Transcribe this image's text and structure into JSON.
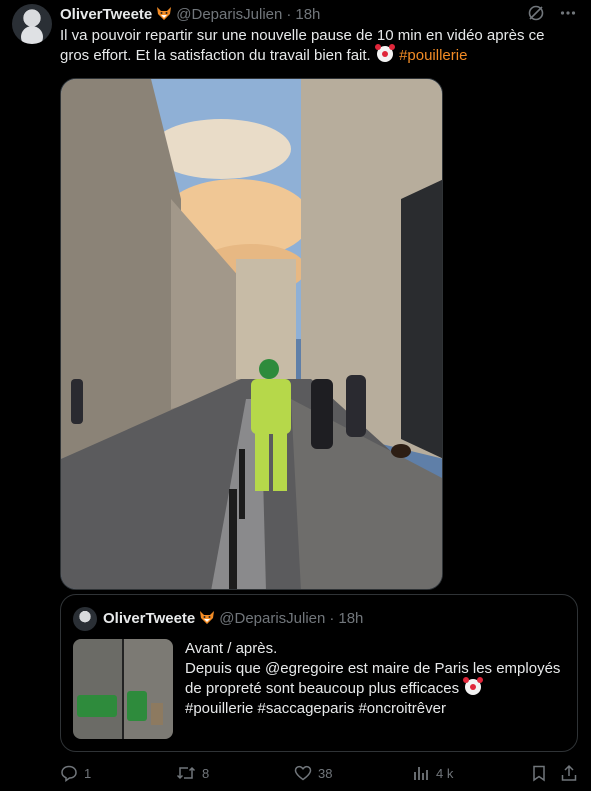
{
  "post": {
    "author_name": "OliverTweete",
    "author_handle": "@DeparisJulien",
    "separator": "·",
    "time": "18h",
    "text_line1": "Il va pouvoir repartir sur une nouvelle pause de 10 min en vidéo après ce",
    "text_line2": "gros effort. Et la satisfaction du travail bien fait.",
    "hashtag": "#pouillerie"
  },
  "quote": {
    "author_name": "OliverTweete",
    "author_handle": "@DeparisJulien",
    "separator": "·",
    "time": "18h",
    "line1": "Avant / après.",
    "line2": "Depuis que @egregoire est maire de Paris les employés",
    "line3": "de propreté sont beaucoup plus efficaces",
    "line4": "#pouillerie #saccageparis #oncroitrêver"
  },
  "actions": {
    "replies": "1",
    "reposts": "8",
    "likes": "38",
    "views": "4 k"
  },
  "icons": {
    "fox": "fox-emoji-icon",
    "clown": "clown-emoji-icon",
    "grok": "grok-icon",
    "more": "more-icon",
    "reply": "reply-icon",
    "repost": "repost-icon",
    "like": "heart-icon",
    "views": "views-icon",
    "bookmark": "bookmark-icon",
    "share": "share-icon"
  },
  "colors": {
    "background": "#000000",
    "text": "#e7e9ea",
    "muted": "#71767b",
    "hashtag": "#f28b25",
    "border": "#2f3336"
  }
}
